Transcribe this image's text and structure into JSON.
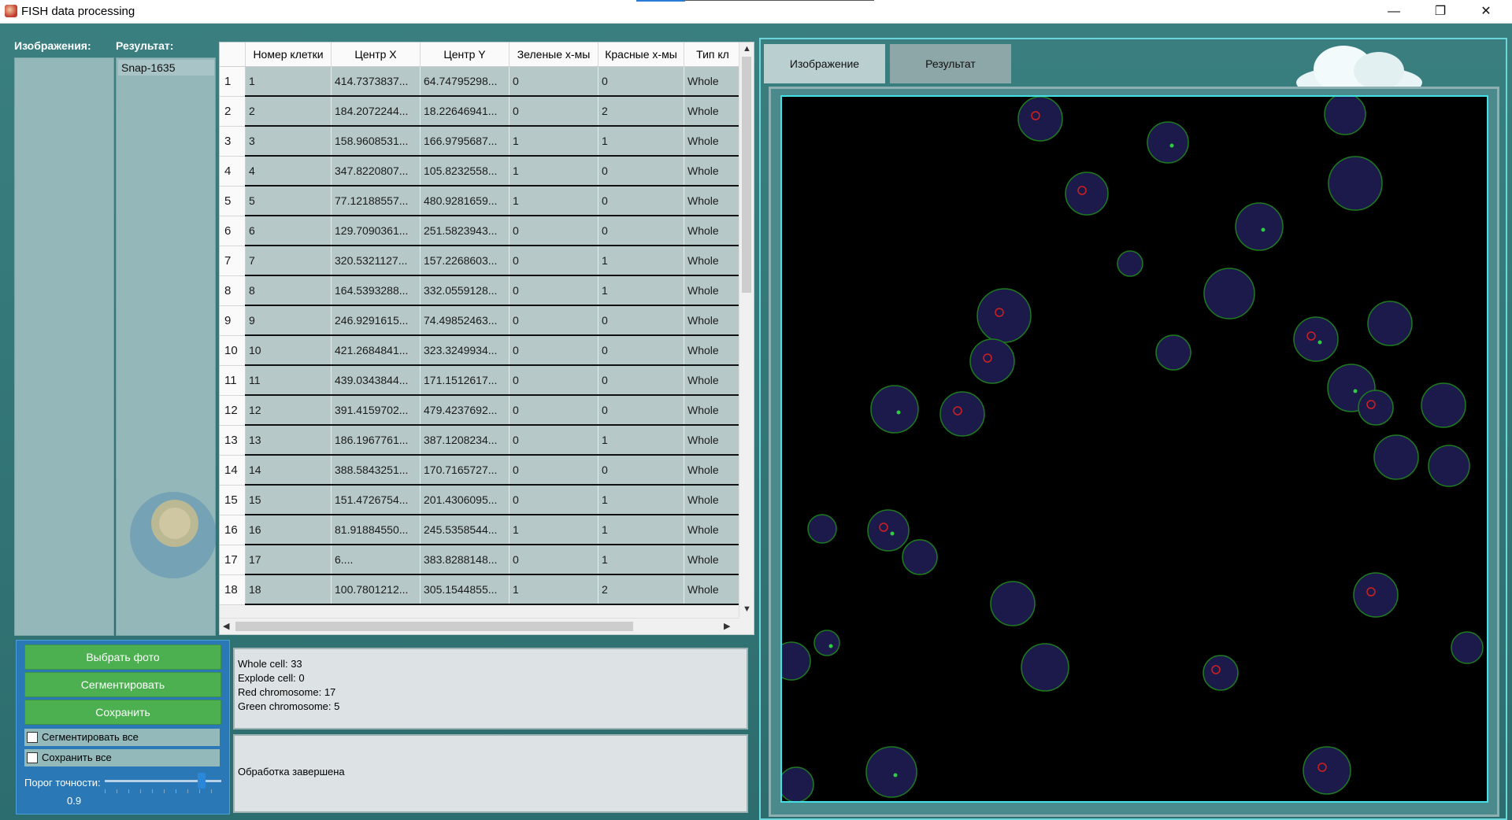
{
  "window": {
    "title": "FISH data processing",
    "minimize": "—",
    "maximize": "❐",
    "close": "✕"
  },
  "left": {
    "images_header": "Изображения:",
    "result_header": "Результат:",
    "result_items": [
      "Snap-1635"
    ]
  },
  "table": {
    "columns": [
      "Номер клетки",
      "Центр X",
      "Центр Y",
      "Зеленые х-мы",
      "Красные х-мы",
      "Тип кл"
    ],
    "rows": [
      [
        "1",
        "414.7373837...",
        "64.74795298...",
        "0",
        "0",
        "Whole"
      ],
      [
        "2",
        "184.2072244...",
        "18.22646941...",
        "0",
        "2",
        "Whole"
      ],
      [
        "3",
        "158.9608531...",
        "166.9795687...",
        "1",
        "1",
        "Whole"
      ],
      [
        "4",
        "347.8220807...",
        "105.8232558...",
        "1",
        "0",
        "Whole"
      ],
      [
        "5",
        "77.12188557...",
        "480.9281659...",
        "1",
        "0",
        "Whole"
      ],
      [
        "6",
        "129.7090361...",
        "251.5823943...",
        "0",
        "0",
        "Whole"
      ],
      [
        "7",
        "320.5321127...",
        "157.2268603...",
        "0",
        "1",
        "Whole"
      ],
      [
        "8",
        "164.5393288...",
        "332.0559128...",
        "0",
        "1",
        "Whole"
      ],
      [
        "9",
        "246.9291615...",
        "74.49852463...",
        "0",
        "0",
        "Whole"
      ],
      [
        "10",
        "421.2684841...",
        "323.3249934...",
        "0",
        "0",
        "Whole"
      ],
      [
        "11",
        "439.0343844...",
        "171.1512617...",
        "0",
        "0",
        "Whole"
      ],
      [
        "12",
        "391.4159702...",
        "479.4237692...",
        "0",
        "0",
        "Whole"
      ],
      [
        "13",
        "186.1967761...",
        "387.1208234...",
        "0",
        "1",
        "Whole"
      ],
      [
        "14",
        "388.5843251...",
        "170.7165727...",
        "0",
        "0",
        "Whole"
      ],
      [
        "15",
        "151.4726754...",
        "201.4306095...",
        "0",
        "1",
        "Whole"
      ],
      [
        "16",
        "81.91884550...",
        "245.5358544...",
        "1",
        "1",
        "Whole"
      ],
      [
        "17",
        "6....",
        "383.8288148...",
        "0",
        "1",
        "Whole"
      ],
      [
        "18",
        "100.7801212...",
        "305.1544855...",
        "1",
        "2",
        "Whole"
      ]
    ]
  },
  "controls": {
    "choose_photo": "Выбрать фото",
    "segment": "Сегментировать",
    "save": "Сохранить",
    "segment_all": "Сегментировать все",
    "save_all": "Сохранить все",
    "threshold_label": "Порог точности:",
    "threshold_value": "0.9"
  },
  "info": {
    "lines": [
      "Whole cell: 33",
      "Explode cell: 0",
      "Red chromosome: 17",
      "Green chromosome: 5"
    ],
    "status": "Обработка завершена"
  },
  "tabs": {
    "image": "Изображение",
    "result": "Результат"
  }
}
